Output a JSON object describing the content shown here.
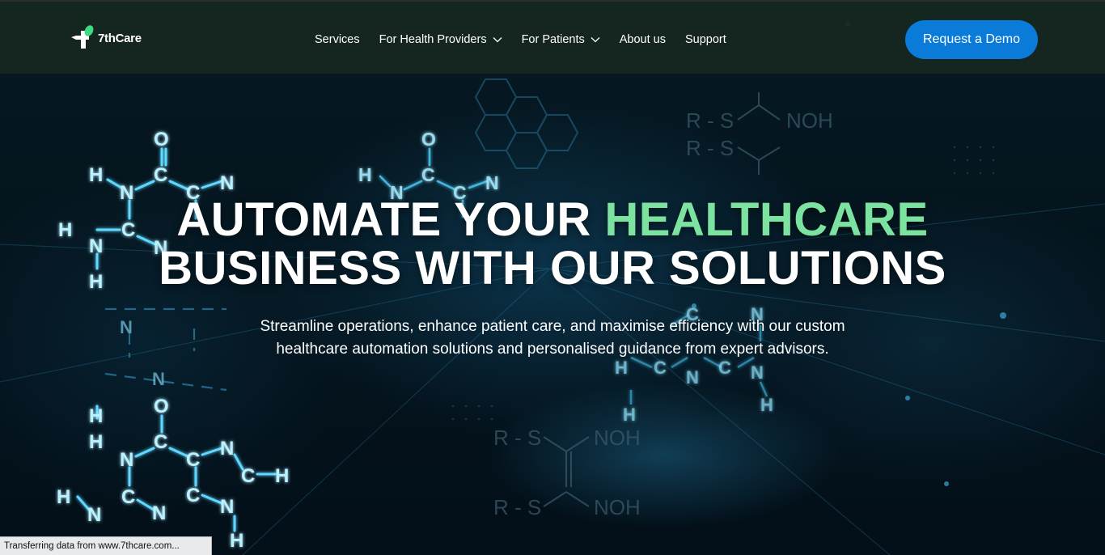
{
  "brand": {
    "name": "7thCare",
    "logo_icon": "cross-leaf-icon",
    "accent": "#7be2a0",
    "primary": "#0a7bd8"
  },
  "nav": {
    "links": [
      {
        "label": "Services",
        "has_dropdown": false
      },
      {
        "label": "For Health Providers",
        "has_dropdown": true
      },
      {
        "label": "For Patients",
        "has_dropdown": true
      },
      {
        "label": "About us",
        "has_dropdown": false
      },
      {
        "label": "Support",
        "has_dropdown": false
      }
    ],
    "cta": "Request a Demo"
  },
  "hero": {
    "headline_part1": "AUTOMATE YOUR ",
    "headline_accent": "HEALTHCARE",
    "headline_line2": "BUSINESS WITH OUR SOLUTIONS",
    "subtext": "Streamline operations, enhance patient care, and maximise efficiency with our custom healthcare automation solutions and personalised guidance from expert advisors."
  },
  "status_bar": {
    "text": "Transferring data from www.7thcare.com..."
  }
}
